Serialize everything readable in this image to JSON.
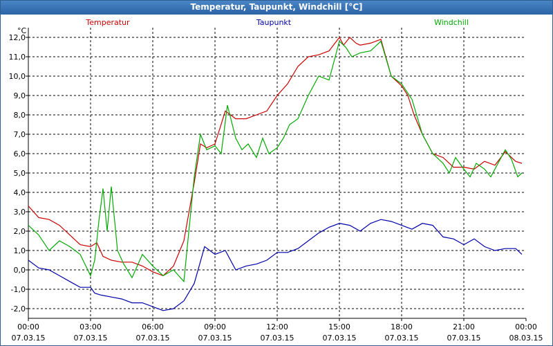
{
  "window": {
    "title": "Temperatur, Taupunkt, Windchill [°C]"
  },
  "colors": {
    "temperature": "#cc0000",
    "dewpoint": "#0000aa",
    "windchill": "#00aa00",
    "grid": "#000000",
    "titlebar": "#2c63a6"
  },
  "chart_data": {
    "type": "line",
    "title": "Temperatur, Taupunkt, Windchill [°C]",
    "yunit": "°C",
    "xlabel": "",
    "ylabel": "",
    "ylim": [
      -2.5,
      12.5
    ],
    "xlim": [
      0,
      24
    ],
    "grid": true,
    "legend_placement": "top",
    "yticks": [
      -2.0,
      -1.0,
      0.0,
      1.0,
      2.0,
      3.0,
      4.0,
      5.0,
      6.0,
      7.0,
      8.0,
      9.0,
      10.0,
      11.0,
      12.0
    ],
    "ytick_labels": [
      "-2,0",
      "-1,0",
      "0,0",
      "1,0",
      "2,0",
      "3,0",
      "4,0",
      "5,0",
      "6,0",
      "7,0",
      "8,0",
      "9,0",
      "10,0",
      "11,0",
      "12,0"
    ],
    "xticks": [
      0,
      3,
      6,
      9,
      12,
      15,
      18,
      21,
      24
    ],
    "xtick_time": [
      "00:00",
      "03:00",
      "06:00",
      "09:00",
      "12:00",
      "15:00",
      "18:00",
      "21:00",
      "00:00"
    ],
    "xtick_date": [
      "07.03.15",
      "07.03.15",
      "07.03.15",
      "07.03.15",
      "07.03.15",
      "07.03.15",
      "07.03.15",
      "07.03.15",
      "08.03.15"
    ],
    "series": [
      {
        "name": "Temperatur",
        "color": "#cc0000",
        "x": [
          0,
          0.5,
          1,
          1.5,
          2,
          2.5,
          3,
          3.3,
          3.6,
          4,
          4.5,
          5,
          5.5,
          6,
          6.5,
          7,
          7.5,
          8,
          8.3,
          8.6,
          9,
          9.5,
          10,
          10.5,
          11,
          11.5,
          12,
          12.5,
          13,
          13.5,
          14,
          14.5,
          15,
          15.2,
          15.5,
          15.8,
          16,
          16.5,
          17,
          17.5,
          18,
          18.3,
          18.6,
          19,
          19.5,
          20,
          20.5,
          21,
          21.5,
          22,
          22.5,
          23,
          23.5,
          23.8
        ],
        "y": [
          3.3,
          2.7,
          2.6,
          2.3,
          1.8,
          1.3,
          1.2,
          1.4,
          0.7,
          0.5,
          0.4,
          0.4,
          0.2,
          -0.1,
          -0.3,
          0.2,
          1.5,
          4.5,
          6.5,
          6.3,
          6.5,
          8.2,
          7.8,
          7.8,
          8.0,
          8.2,
          9.0,
          9.6,
          10.5,
          11.0,
          11.1,
          11.3,
          12.0,
          11.6,
          12.0,
          11.7,
          11.6,
          11.7,
          11.9,
          10.0,
          9.5,
          9.0,
          8.0,
          7.0,
          6.0,
          5.8,
          5.3,
          5.3,
          5.2,
          5.6,
          5.4,
          6.1,
          5.6,
          5.5
        ]
      },
      {
        "name": "Taupunkt",
        "color": "#0000aa",
        "x": [
          0,
          0.5,
          1,
          1.5,
          2,
          2.5,
          3,
          3.2,
          3.5,
          4,
          4.5,
          5,
          5.5,
          6,
          6.5,
          7,
          7.5,
          8,
          8.5,
          9,
          9.5,
          10,
          10.5,
          11,
          11.5,
          12,
          12.5,
          13,
          13.5,
          14,
          14.5,
          15,
          15.5,
          16,
          16.5,
          17,
          17.5,
          18,
          18.5,
          19,
          19.5,
          20,
          20.5,
          21,
          21.5,
          22,
          22.5,
          23,
          23.5,
          23.8
        ],
        "y": [
          0.5,
          0.1,
          0.0,
          -0.3,
          -0.6,
          -0.9,
          -0.9,
          -1.2,
          -1.3,
          -1.4,
          -1.5,
          -1.7,
          -1.7,
          -1.9,
          -2.1,
          -2.0,
          -1.6,
          -0.7,
          1.2,
          0.8,
          1.0,
          0.0,
          0.2,
          0.3,
          0.5,
          0.9,
          0.9,
          1.1,
          1.5,
          1.9,
          2.2,
          2.4,
          2.3,
          2.0,
          2.4,
          2.6,
          2.5,
          2.3,
          2.1,
          2.4,
          2.3,
          1.7,
          1.6,
          1.3,
          1.6,
          1.2,
          1.0,
          1.1,
          1.1,
          0.8
        ]
      },
      {
        "name": "Windchill",
        "color": "#00aa00",
        "x": [
          0,
          0.5,
          1,
          1.5,
          2,
          2.5,
          3,
          3.2,
          3.4,
          3.6,
          3.8,
          4,
          4.3,
          4.6,
          5,
          5.5,
          6,
          6.5,
          7,
          7.5,
          8,
          8.3,
          8.6,
          9,
          9.3,
          9.6,
          10,
          10.3,
          10.6,
          11,
          11.3,
          11.6,
          12,
          12.3,
          12.6,
          13,
          13.5,
          14,
          14.5,
          15,
          15.3,
          15.6,
          16,
          16.5,
          17,
          17.5,
          18,
          18.5,
          19,
          19.5,
          20,
          20.3,
          20.6,
          21,
          21.3,
          21.6,
          22,
          22.3,
          22.6,
          23,
          23.3,
          23.6,
          23.8
        ],
        "y": [
          2.3,
          1.8,
          1.0,
          1.5,
          1.2,
          0.8,
          -0.3,
          0.5,
          2.5,
          4.2,
          2.0,
          4.3,
          1.0,
          0.3,
          -0.4,
          0.8,
          0.2,
          -0.3,
          0.0,
          -0.6,
          4.8,
          7.0,
          6.2,
          6.4,
          6.0,
          8.5,
          6.8,
          6.2,
          6.5,
          5.8,
          6.8,
          6.0,
          6.3,
          6.8,
          7.5,
          7.8,
          9.0,
          10.0,
          9.8,
          11.8,
          11.5,
          11.0,
          11.2,
          11.3,
          11.8,
          10.0,
          9.6,
          8.8,
          7.0,
          6.0,
          5.5,
          5.0,
          5.8,
          5.2,
          4.8,
          5.5,
          5.2,
          4.8,
          5.4,
          6.2,
          5.7,
          4.8,
          5.0
        ]
      }
    ]
  }
}
